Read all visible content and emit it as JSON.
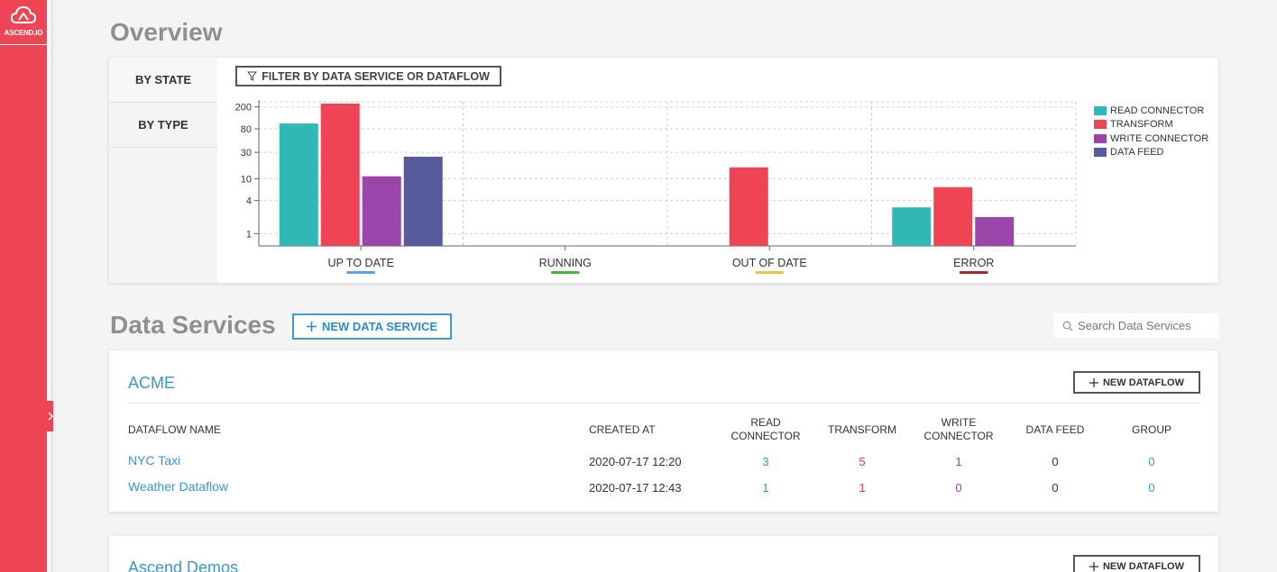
{
  "app": {
    "logo_text": "ASCEND.IO"
  },
  "overview": {
    "title": "Overview",
    "tabs": [
      {
        "label": "BY STATE",
        "active": true
      },
      {
        "label": "BY TYPE",
        "active": false
      }
    ],
    "filter_label": "FILTER BY DATA SERVICE OR DATAFLOW"
  },
  "chart_data": {
    "type": "bar",
    "y_scale": "log",
    "y_ticks": [
      "200",
      "80",
      "30",
      "10",
      "4",
      "1"
    ],
    "categories": [
      "UP TO DATE",
      "RUNNING",
      "OUT OF DATE",
      "ERROR"
    ],
    "category_colors": [
      "#5ba4e0",
      "#4bb340",
      "#f0c243",
      "#a72935"
    ],
    "series": [
      {
        "name": "READ CONNECTOR",
        "color": "#2fb8b6",
        "values": [
          100,
          0,
          0,
          3
        ]
      },
      {
        "name": "TRANSFORM",
        "color": "#ef4456",
        "values": [
          230,
          0,
          16,
          7
        ]
      },
      {
        "name": "WRITE CONNECTOR",
        "color": "#9b45aa",
        "values": [
          11,
          0,
          0,
          2
        ]
      },
      {
        "name": "DATA FEED",
        "color": "#575b9c",
        "values": [
          25,
          0,
          0,
          0
        ]
      }
    ],
    "grid": true,
    "legend_position": "right"
  },
  "data_services": {
    "title": "Data Services",
    "new_button": "NEW DATA SERVICE",
    "search_placeholder": "Search Data Services",
    "new_dataflow_label": "NEW DATAFLOW",
    "columns": {
      "name": "DATAFLOW NAME",
      "created": "CREATED AT",
      "read_1": "READ",
      "read_2": "CONNECTOR",
      "transform": "TRANSFORM",
      "write_1": "WRITE",
      "write_2": "CONNECTOR",
      "feed": "DATA FEED",
      "group": "GROUP"
    },
    "services": [
      {
        "name": "ACME",
        "rows": [
          {
            "name": "NYC Taxi",
            "created": "2020-07-17 12:20",
            "read": "3",
            "transform": "5",
            "write": "1",
            "feed": "0",
            "group": "0"
          },
          {
            "name": "Weather Dataflow",
            "created": "2020-07-17 12:43",
            "read": "1",
            "transform": "1",
            "write": "0",
            "feed": "0",
            "group": "0"
          }
        ]
      },
      {
        "name": "Ascend Demos"
      }
    ]
  }
}
